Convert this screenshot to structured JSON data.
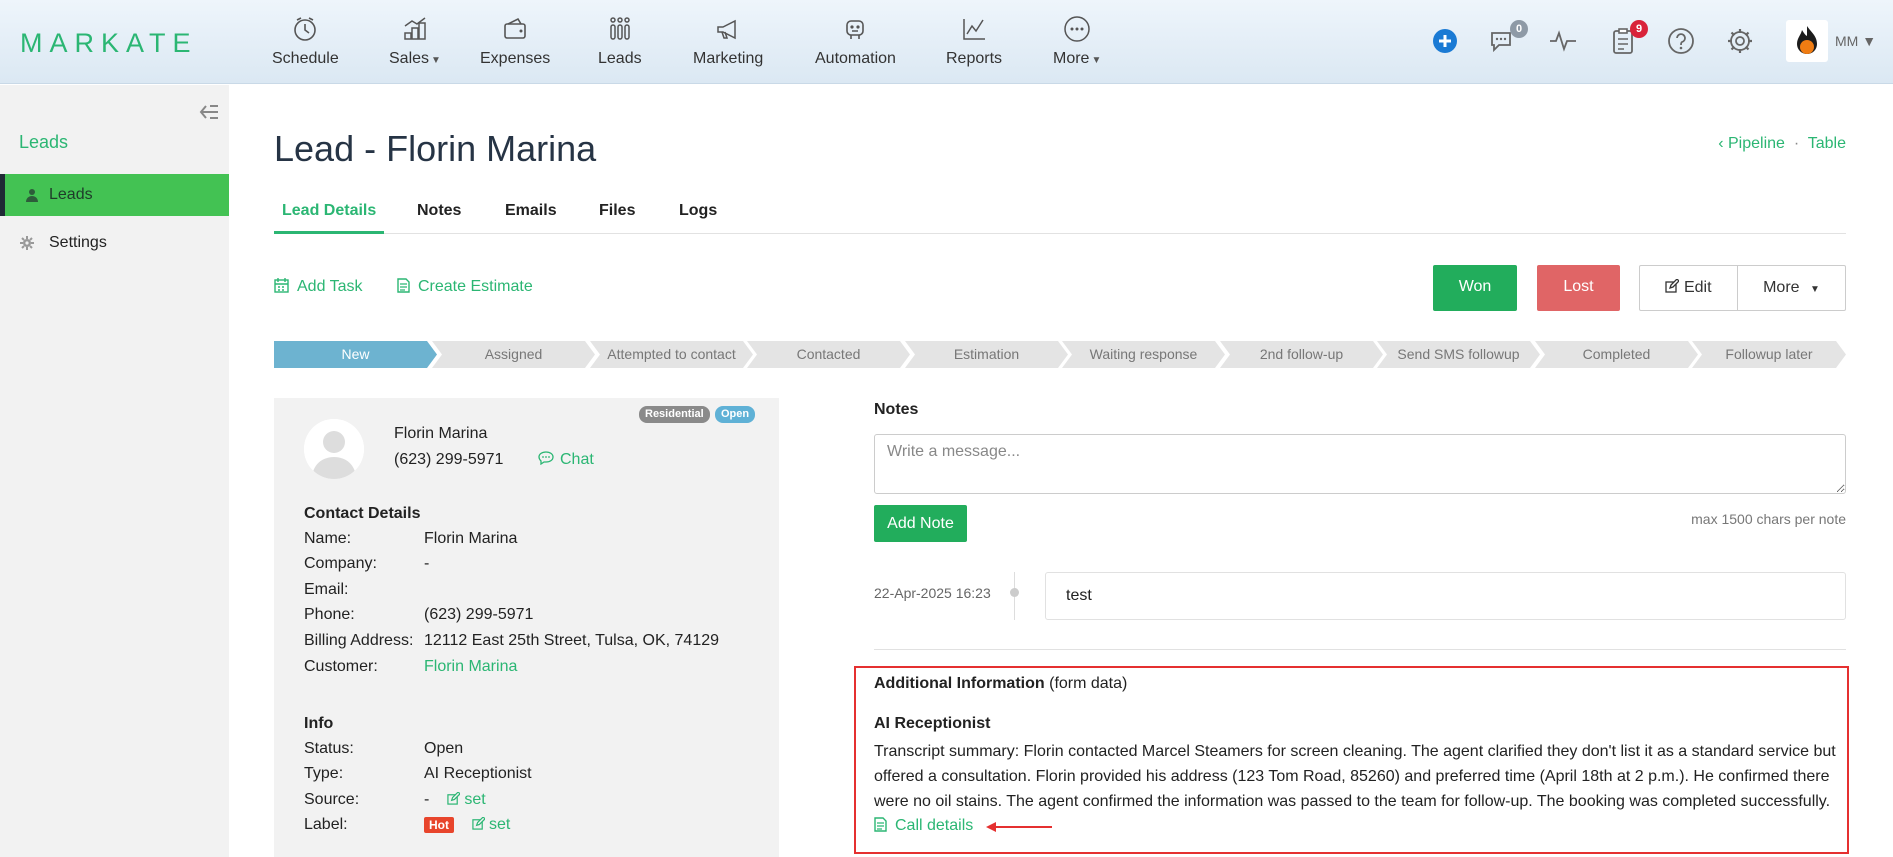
{
  "app": {
    "logo": "MARKATE",
    "user_initials": "MM"
  },
  "nav": [
    {
      "label": "Schedule",
      "icon": "clock-icon"
    },
    {
      "label": "Sales",
      "icon": "sales-chart-icon",
      "dropdown": true
    },
    {
      "label": "Expenses",
      "icon": "wallet-icon"
    },
    {
      "label": "Leads",
      "icon": "funnel-bars-icon"
    },
    {
      "label": "Marketing",
      "icon": "megaphone-icon"
    },
    {
      "label": "Automation",
      "icon": "robot-icon"
    },
    {
      "label": "Reports",
      "icon": "line-chart-icon"
    },
    {
      "label": "More",
      "icon": "ellipsis-circle-icon",
      "dropdown": true
    }
  ],
  "toolbar": {
    "messages_count": "0",
    "tasks_count": "9"
  },
  "sidebar": {
    "title": "Leads",
    "items": [
      {
        "label": "Leads",
        "icon": "user-icon",
        "active": true
      },
      {
        "label": "Settings",
        "icon": "gear-icon",
        "active": false
      }
    ]
  },
  "page": {
    "title": "Lead - Florin Marina",
    "links": {
      "pipeline": "Pipeline",
      "separator": "·",
      "table": "Table"
    }
  },
  "tabs": [
    "Lead Details",
    "Notes",
    "Emails",
    "Files",
    "Logs"
  ],
  "actions": {
    "add_task": "Add Task",
    "create_estimate": "Create Estimate",
    "won": "Won",
    "lost": "Lost",
    "edit": "Edit",
    "more": "More"
  },
  "pipeline": [
    "New",
    "Assigned",
    "Attempted to contact",
    "Contacted",
    "Estimation",
    "Waiting response",
    "2nd follow-up",
    "Send SMS followup",
    "Completed",
    "Followup later"
  ],
  "lead": {
    "tags": {
      "type": "Residential",
      "status": "Open"
    },
    "name": "Florin Marina",
    "phone": "(623) 299-5971",
    "chat_label": "Chat",
    "contact_title": "Contact Details",
    "contact": [
      {
        "key": "Name:",
        "value": "Florin Marina"
      },
      {
        "key": "Company:",
        "value": "-"
      },
      {
        "key": "Email:",
        "value": ""
      },
      {
        "key": "Phone:",
        "value": "(623) 299-5971"
      },
      {
        "key": "Billing Address:",
        "value": "12112 East 25th Street, Tulsa, OK, 74129"
      },
      {
        "key": "Customer:",
        "value": "Florin Marina"
      }
    ],
    "info_title": "Info",
    "info": {
      "status_key": "Status:",
      "status": "Open",
      "type_key": "Type:",
      "type": "AI Receptionist",
      "source_key": "Source:",
      "source": "-",
      "label_key": "Label:",
      "label": "Hot",
      "set_label": "set"
    }
  },
  "notes": {
    "title": "Notes",
    "placeholder": "Write a message...",
    "add_button": "Add Note",
    "limit": "max 1500 chars per note",
    "entries": [
      {
        "date": "22-Apr-2025 16:23",
        "text": "test"
      }
    ]
  },
  "additional": {
    "title": "Additional Information",
    "subtitle": "(form data)",
    "section": "AI Receptionist",
    "body": "Transcript summary: Florin contacted Marcel Steamers for screen cleaning. The agent clarified they don't list it as a standard service but offered a consultation. Florin provided his address (123 Tom Road, 85260) and preferred time (April 18th at 2 p.m.). He confirmed there were no oil stains. The agent confirmed the information was passed to the team for follow-up. The booking was completed successfully.",
    "call_details": "Call details"
  },
  "colors": {
    "brand": "#2bb673",
    "won": "#22ad5c",
    "lost": "#e06566",
    "active_stage": "#6db3d0",
    "annotation": "#e53030"
  }
}
